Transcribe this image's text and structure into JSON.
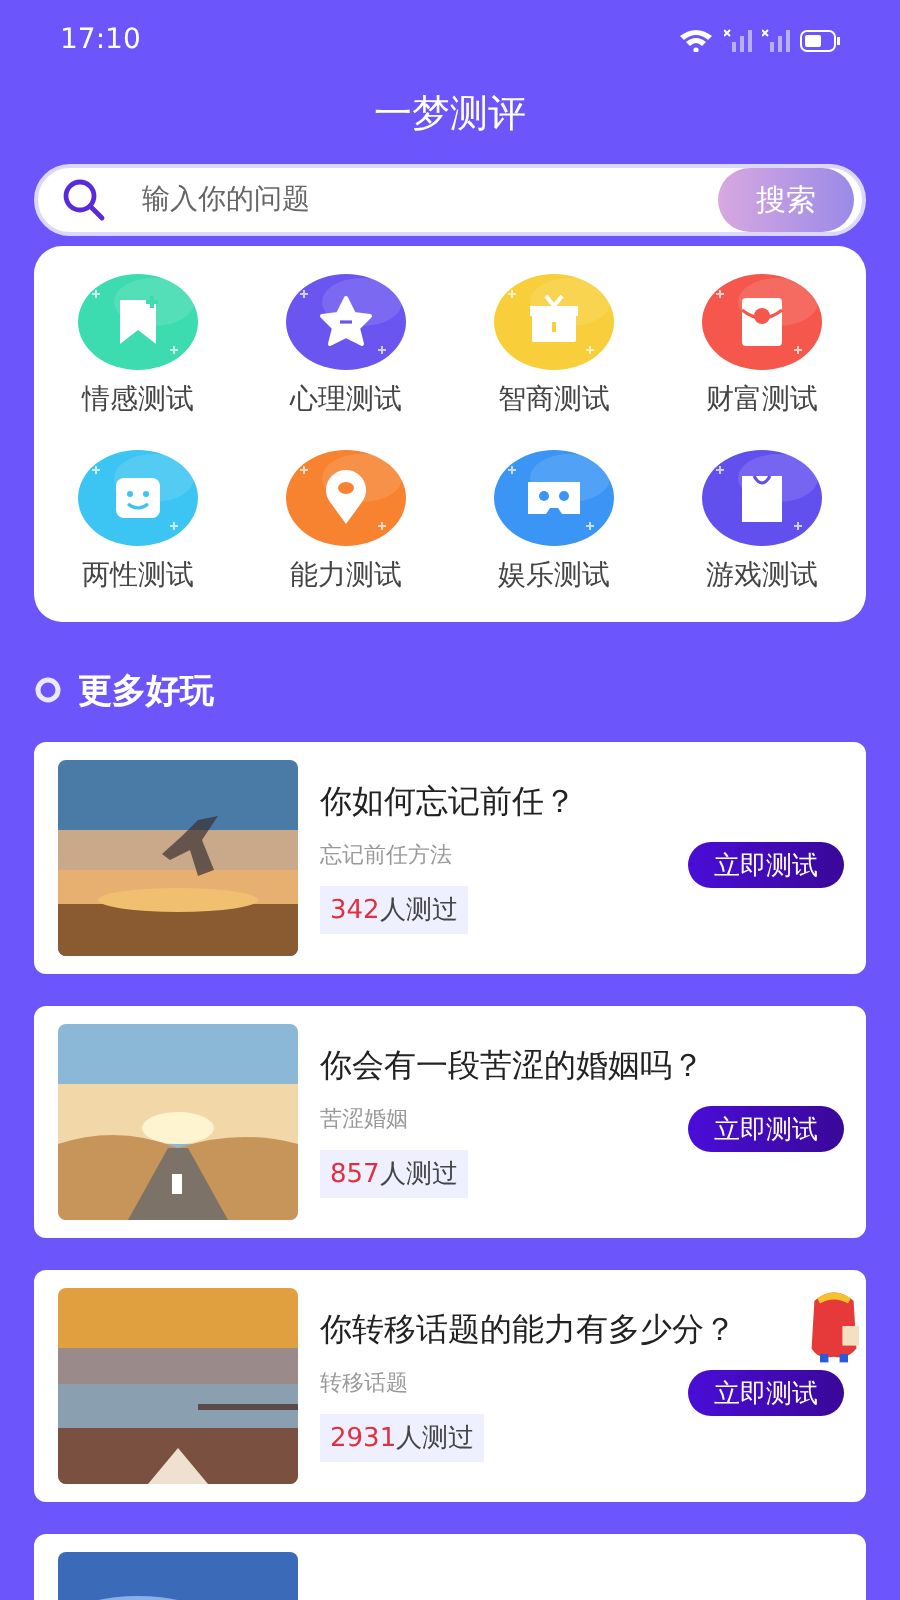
{
  "status_bar": {
    "time": "17:10"
  },
  "header": {
    "title": "一梦测评"
  },
  "search": {
    "placeholder": "输入你的问题",
    "button": "搜索"
  },
  "categories": [
    {
      "label": "情感测试",
      "color": "#3ddbb0",
      "kind": "bookmark"
    },
    {
      "label": "心理测试",
      "color": "#6a55f0",
      "kind": "star"
    },
    {
      "label": "智商测试",
      "color": "#f8cf3a",
      "kind": "gift"
    },
    {
      "label": "财富测试",
      "color": "#f5574c",
      "kind": "envelope"
    },
    {
      "label": "两性测试",
      "color": "#3cc4f2",
      "kind": "smile"
    },
    {
      "label": "能力测试",
      "color": "#f7822f",
      "kind": "pin"
    },
    {
      "label": "娱乐测试",
      "color": "#3a95f5",
      "kind": "vr"
    },
    {
      "label": "游戏测试",
      "color": "#6250ee",
      "kind": "bag"
    }
  ],
  "section": {
    "title": "更多好玩"
  },
  "tests": [
    {
      "title": "你如何忘记前任？",
      "subtitle": "忘记前任方法",
      "count": "342",
      "count_suffix": "人测过",
      "button": "立即测试"
    },
    {
      "title": "你会有一段苦涩的婚姻吗？",
      "subtitle": "苦涩婚姻",
      "count": "857",
      "count_suffix": "人测过",
      "button": "立即测试"
    },
    {
      "title": "你转移话题的能力有多少分？",
      "subtitle": "转移话题",
      "count": "2931",
      "count_suffix": "人测过",
      "button": "立即测试",
      "sticker": true
    },
    {
      "kind": "picture"
    }
  ]
}
